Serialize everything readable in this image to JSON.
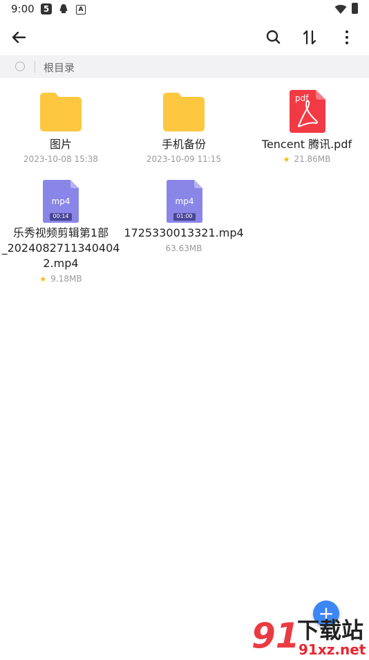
{
  "status_bar": {
    "time": "9:00",
    "icons": [
      "app-5-icon",
      "qq-icon",
      "a-icon",
      "wifi-icon",
      "battery-icon"
    ]
  },
  "toolbar": {
    "back_icon": "arrow-left-icon",
    "search_icon": "search-icon",
    "sort_icon": "sort-icon",
    "more_icon": "more-vertical-icon"
  },
  "breadcrumb": {
    "label": "根目录"
  },
  "files": [
    {
      "name": "图片",
      "meta": "2023-10-08 15:38",
      "type": "folder",
      "starred": false
    },
    {
      "name": "手机备份",
      "meta": "2023-10-09 11:15",
      "type": "folder",
      "starred": false
    },
    {
      "name": "Tencent 腾讯.pdf",
      "meta": "21.86MB",
      "type": "pdf",
      "icon_label": "pdf",
      "starred": true
    },
    {
      "name_lines": [
        "乐秀视频剪辑第1部",
        "_2024082711340404",
        "2.mp4"
      ],
      "meta": "9.18MB",
      "type": "mp4",
      "icon_label": "mp4",
      "duration": "00:14",
      "starred": true
    },
    {
      "name": "1725330013321.mp4",
      "meta": "63.63MB",
      "type": "mp4",
      "icon_label": "mp4",
      "duration": "01:00",
      "starred": false
    }
  ],
  "fab": {
    "icon": "plus-icon"
  },
  "watermark": {
    "logo_text": "91",
    "title": "下载站",
    "domain": "91xz.net"
  },
  "colors": {
    "folder": "#fdc840",
    "pdf": "#f23a45",
    "video": "#8a86e8",
    "fab": "#3d86f5",
    "star": "#f5b700",
    "watermark_red": "#e8262e"
  }
}
